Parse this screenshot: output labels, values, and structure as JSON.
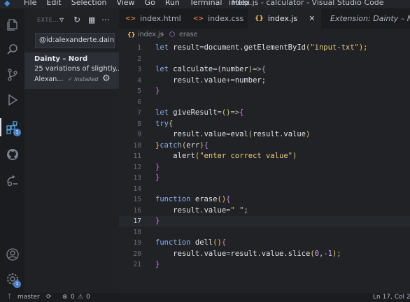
{
  "window": {
    "title": "index.js - calculator - Visual Studio Code",
    "menu": [
      "File",
      "Edit",
      "Selection",
      "View",
      "Go",
      "Run",
      "Terminal",
      "Help"
    ]
  },
  "activity_bar": {
    "extensions_badge": "1",
    "settings_badge": "1"
  },
  "sidebar": {
    "title": "EXTE...",
    "search_value": "@id:alexanderte.dainty-n",
    "extension": {
      "name": "Dainty – Nord",
      "description": "25 variations of slightly...",
      "publisher": "Alexan...",
      "status": "✓ Installed"
    }
  },
  "tabs": [
    {
      "icon": "<>",
      "label": "index.html",
      "color": "#e8834a"
    },
    {
      "icon": "<>",
      "label": "index.css",
      "color": "#e8834a"
    },
    {
      "icon": "{}",
      "label": "index.js",
      "color": "#e8c36e",
      "close": "✕"
    },
    {
      "label": "Extension: Dainty – Nord"
    }
  ],
  "breadcrumb": {
    "file": "index.js",
    "symbol": "erase"
  },
  "code_lines": [
    {
      "n": "1"
    },
    {
      "n": "2"
    },
    {
      "n": "3"
    },
    {
      "n": "4"
    },
    {
      "n": "5"
    },
    {
      "n": "6"
    },
    {
      "n": "7"
    },
    {
      "n": "8"
    },
    {
      "n": "9"
    },
    {
      "n": "10"
    },
    {
      "n": "11"
    },
    {
      "n": "12"
    },
    {
      "n": "13"
    },
    {
      "n": "14"
    },
    {
      "n": "15"
    },
    {
      "n": "16"
    },
    {
      "n": "17"
    },
    {
      "n": "18"
    },
    {
      "n": "19"
    },
    {
      "n": "20"
    },
    {
      "n": "21"
    }
  ],
  "code": {
    "l1": [
      "let ",
      "result",
      "=",
      "document",
      ".",
      "getElementById",
      "(",
      "\"input-txt\"",
      ");"
    ],
    "l3": [
      "let ",
      "calculate",
      "=",
      "(",
      "number",
      ")",
      "=>",
      "{"
    ],
    "l4": [
      "    ",
      "result",
      ".",
      "value",
      "+=",
      "number",
      ";"
    ],
    "l5": [
      "}"
    ],
    "l7": [
      "let ",
      "giveResult",
      "=",
      "()",
      "=>",
      "{"
    ],
    "l8": [
      "try",
      "{"
    ],
    "l9": [
      "    ",
      "result",
      ".",
      "value",
      "=",
      "eval",
      "(",
      "result",
      ".",
      "value",
      ")"
    ],
    "l10": [
      "}",
      "catch",
      "(",
      "err",
      ")",
      "{"
    ],
    "l11": [
      "    ",
      "alert",
      "(",
      "\"enter correct value\"",
      ")"
    ],
    "l12": [
      "}"
    ],
    "l13": [
      "}"
    ],
    "l15": [
      "function ",
      "erase",
      "()",
      "{"
    ],
    "l16": [
      "    ",
      "result",
      ".",
      "value",
      "=",
      "\" \"",
      ";"
    ],
    "l17": [
      "}"
    ],
    "l19": [
      "function ",
      "dell",
      "()",
      "{"
    ],
    "l20": [
      "    ",
      "result",
      ".",
      "value",
      "=",
      "result",
      ".",
      "value",
      ".",
      "slice",
      "(",
      "0",
      ",",
      "-1",
      ");"
    ],
    "l21": [
      "}"
    ]
  },
  "status_bar": {
    "branch": "master",
    "errors": "0",
    "warnings": "0",
    "position": "Ln 17, Col 2"
  }
}
